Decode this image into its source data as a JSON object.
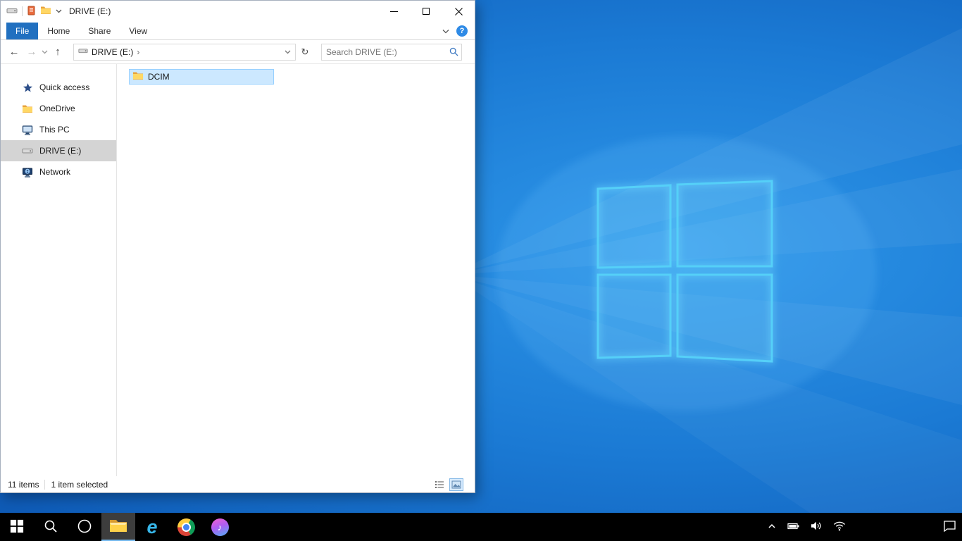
{
  "window": {
    "title": "DRIVE (E:)"
  },
  "ribbon": {
    "tabs": [
      {
        "label": "File",
        "active": true
      },
      {
        "label": "Home",
        "active": false
      },
      {
        "label": "Share",
        "active": false
      },
      {
        "label": "View",
        "active": false
      }
    ]
  },
  "navbar": {
    "breadcrumb_root": "DRIVE (E:)",
    "breadcrumb_chevron": "›",
    "search_placeholder": "Search DRIVE (E:)"
  },
  "sidebar": {
    "items": [
      {
        "label": "Quick access",
        "icon": "star-icon",
        "selected": false
      },
      {
        "label": "OneDrive",
        "icon": "folder-icon",
        "selected": false
      },
      {
        "label": "This PC",
        "icon": "pc-icon",
        "selected": false
      },
      {
        "label": "DRIVE (E:)",
        "icon": "drive-icon",
        "selected": true
      },
      {
        "label": "Network",
        "icon": "network-icon",
        "selected": false
      }
    ]
  },
  "files": {
    "items": [
      {
        "name": "DCIM",
        "type": "folder",
        "selected": true
      }
    ]
  },
  "statusbar": {
    "items_count": "11 items",
    "selection": "1 item selected"
  },
  "taskbar": {
    "buttons": [
      {
        "icon": "start-icon",
        "active": false
      },
      {
        "icon": "search-icon",
        "active": false
      },
      {
        "icon": "cortana-icon",
        "active": false
      },
      {
        "icon": "file-explorer-icon",
        "active": true
      },
      {
        "icon": "internet-explorer-icon",
        "active": false
      },
      {
        "icon": "chrome-icon",
        "active": false
      },
      {
        "icon": "itunes-icon",
        "active": false
      }
    ],
    "tray": [
      {
        "icon": "show-hidden-icons-chevron"
      },
      {
        "icon": "battery-icon"
      },
      {
        "icon": "volume-icon"
      },
      {
        "icon": "wifi-icon"
      },
      {
        "icon": "action-center-icon"
      }
    ]
  },
  "colors": {
    "accent_blue": "#2170c0",
    "selection_bg": "#cce8ff",
    "selection_border": "#99d1ff",
    "sidebar_selected_bg": "#d4d4d4",
    "desktop_base": "#1b7ad4",
    "logo_stroke": "#55d0f8",
    "taskbar_bg": "#000000"
  }
}
